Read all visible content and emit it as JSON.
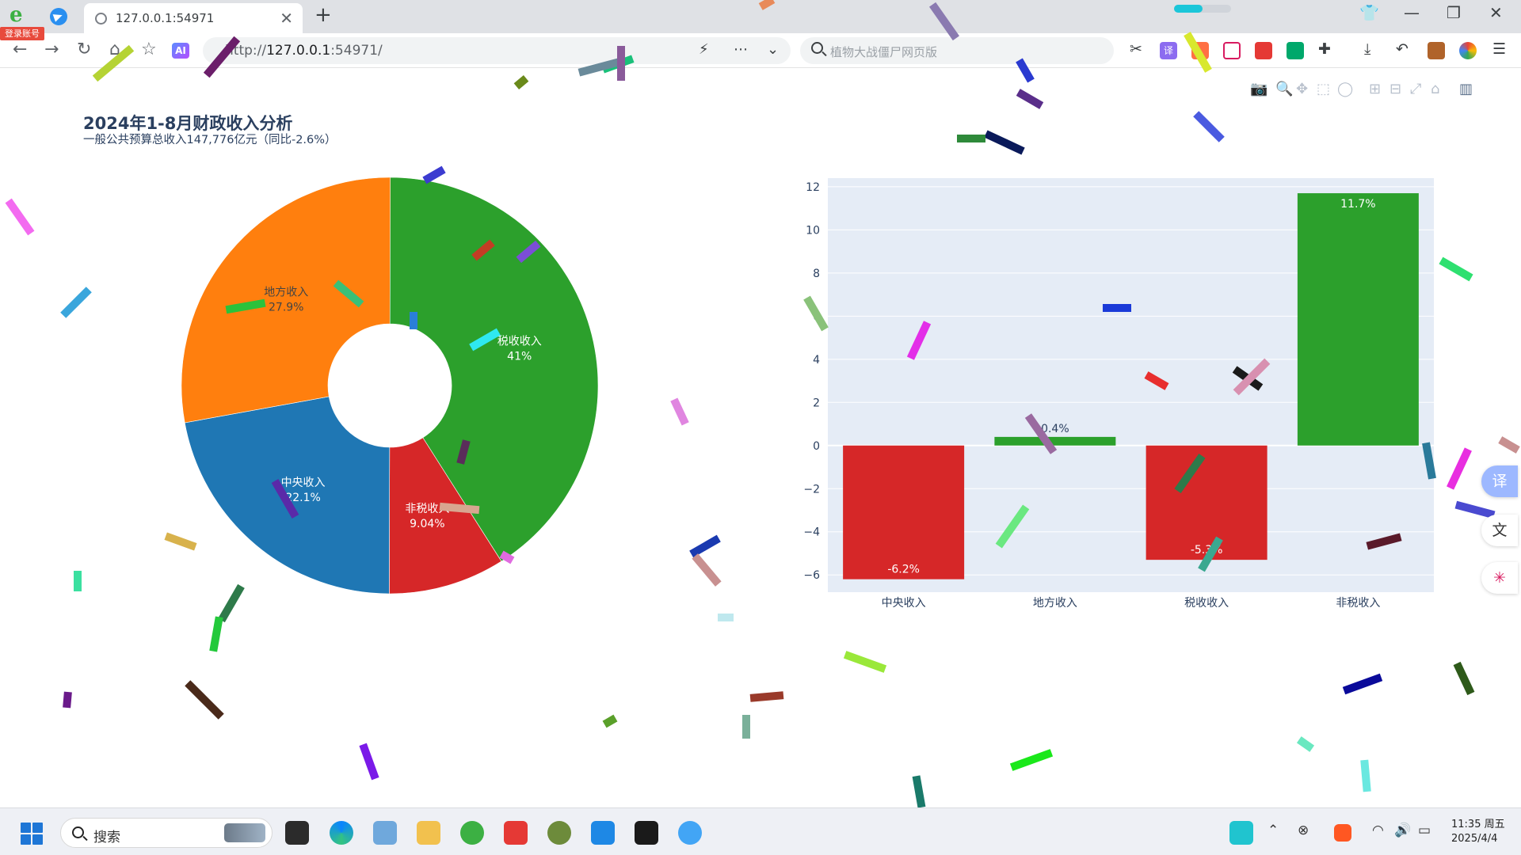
{
  "browser": {
    "login_badge": "登录账号",
    "tab_title": "127.0.0.1:54971",
    "url_scheme": "http://",
    "url_host": "127.0.0.1",
    "url_port": ":54971/",
    "search_placeholder": "植物大战僵尸网页版",
    "translate_label": "译"
  },
  "chart_title": "2024年1-8月财政收入分析",
  "chart_subtitle": "一般公共预算总收入147,776亿元（同比-2.6%）",
  "chart_data": [
    {
      "type": "pie",
      "hole": true,
      "slices": [
        {
          "label": "税收收入",
          "percent": 41,
          "text": "41%",
          "color": "#2ca02c"
        },
        {
          "label": "非税收入",
          "percent": 9.04,
          "text": "9.04%",
          "color": "#d62728"
        },
        {
          "label": "中央收入",
          "percent": 22.1,
          "text": "22.1%",
          "color": "#1f77b4"
        },
        {
          "label": "地方收入",
          "percent": 27.9,
          "text": "27.9%",
          "color": "#ff7f0e"
        }
      ]
    },
    {
      "type": "bar",
      "categories": [
        "中央收入",
        "地方收入",
        "税收收入",
        "非税收入"
      ],
      "values": [
        -6.2,
        0.4,
        -5.3,
        11.7
      ],
      "text": [
        "-6.2%",
        "0.4%",
        "-5.3%",
        "11.7%"
      ],
      "colors": [
        "#d62728",
        "#2ca02c",
        "#d62728",
        "#2ca02c"
      ],
      "ylim": [
        -6.8,
        12.4
      ],
      "yticks": [
        -6,
        -4,
        -2,
        0,
        2,
        4,
        6,
        8,
        10,
        12
      ],
      "ytick_labels": [
        "−6",
        "−4",
        "−2",
        "0",
        "2",
        "4",
        "6",
        "8",
        "10",
        "12"
      ],
      "plot_bg": "#e5ecf6"
    }
  ],
  "taskbar": {
    "search_placeholder": "搜索",
    "time": "11:35 周五",
    "date": "2025/4/4"
  }
}
